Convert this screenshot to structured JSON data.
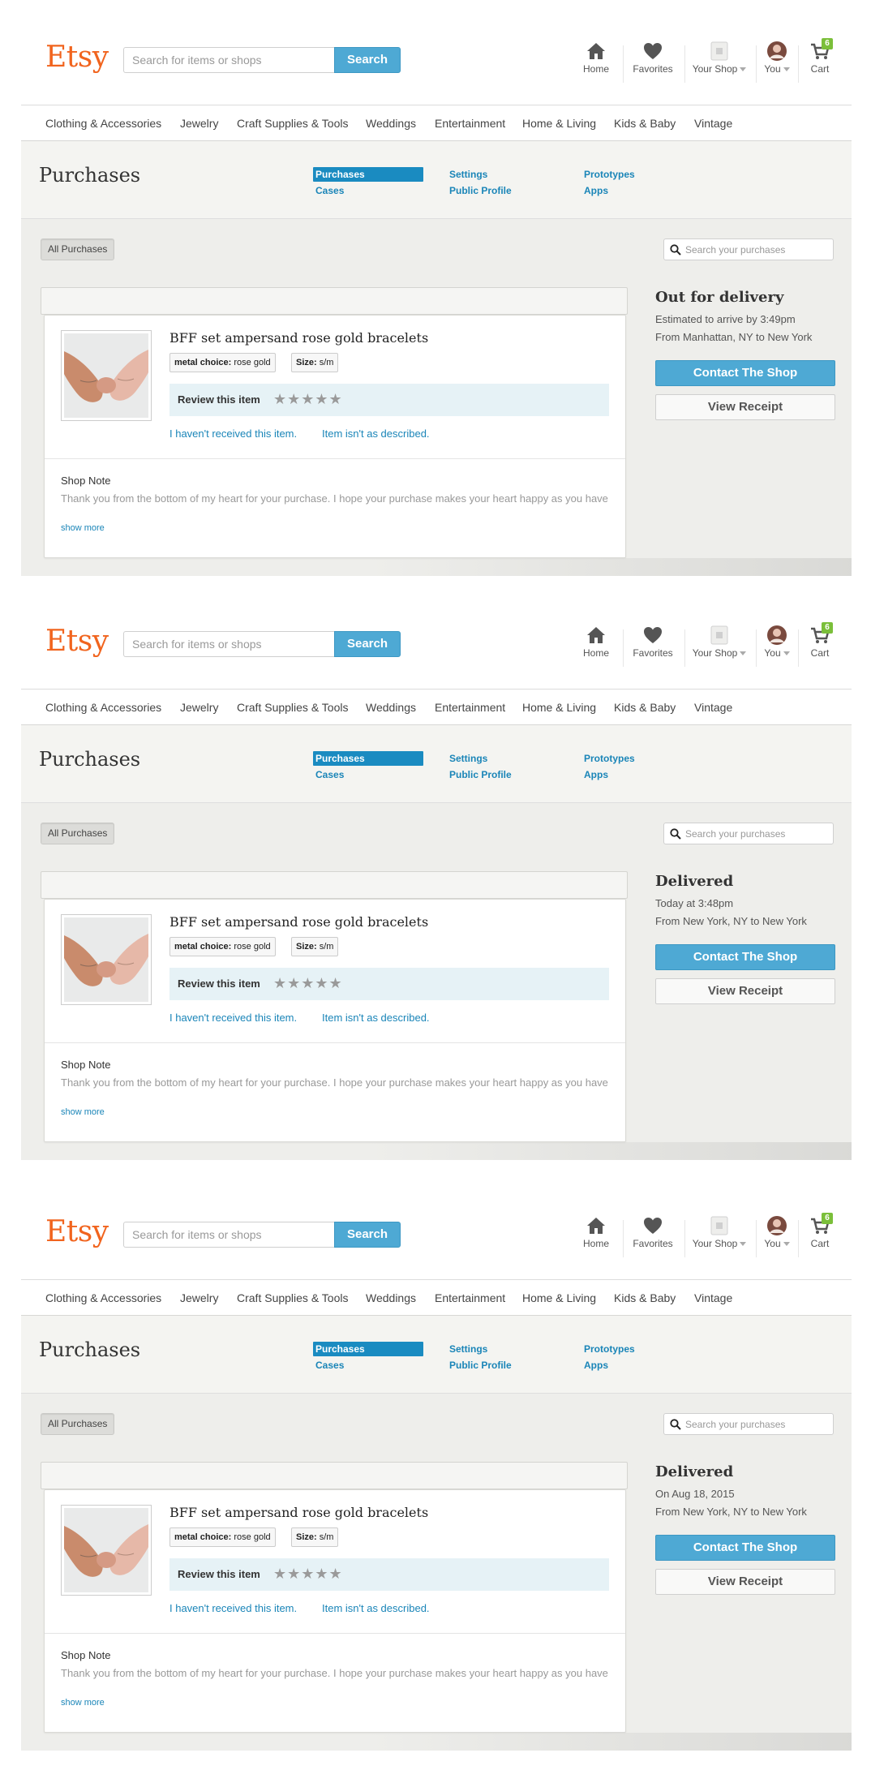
{
  "header": {
    "logo": "Etsy",
    "search_placeholder": "Search for items or shops",
    "search_button": "Search",
    "nav": {
      "home": "Home",
      "favorites": "Favorites",
      "your_shop": "Your Shop",
      "you": "You",
      "cart": "Cart",
      "cart_count": "6"
    }
  },
  "categories": [
    "Clothing & Accessories",
    "Jewelry",
    "Craft Supplies & Tools",
    "Weddings",
    "Entertainment",
    "Home & Living",
    "Kids & Baby",
    "Vintage"
  ],
  "purchases_nav": {
    "title": "Purchases",
    "links": {
      "purchases": "Purchases",
      "cases": "Cases",
      "settings": "Settings",
      "public_profile": "Public Profile",
      "prototypes": "Prototypes",
      "apps": "Apps"
    }
  },
  "toolbar": {
    "all_purchases": "All Purchases",
    "search_placeholder": "Search your purchases"
  },
  "item": {
    "title": "BFF set ampersand rose gold bracelets",
    "attr1_label": "metal choice:",
    "attr1_value": "rose gold",
    "attr2_label": "Size:",
    "attr2_value": "s/m",
    "review_label": "Review this item",
    "stars": "★★★★★",
    "not_received": "I haven't received this item.",
    "not_described": "Item isn't as described.",
    "note_label": "Shop Note",
    "note_text": "Thank you from the bottom of my heart for your purchase. I hope your purchase makes your heart happy as you have made mine!",
    "show_more": "show more"
  },
  "actions": {
    "contact": "Contact The Shop",
    "receipt": "View Receipt"
  },
  "screens": [
    {
      "status": "Out for delivery",
      "line1": "Estimated to arrive by 3:49pm",
      "line2": "From Manhattan, NY to New York"
    },
    {
      "status": "Delivered",
      "line1": "Today at 3:48pm",
      "line2": "From New York, NY to New York"
    },
    {
      "status": "Delivered",
      "line1": "On Aug 18, 2015",
      "line2": "From New York, NY to New York"
    }
  ]
}
